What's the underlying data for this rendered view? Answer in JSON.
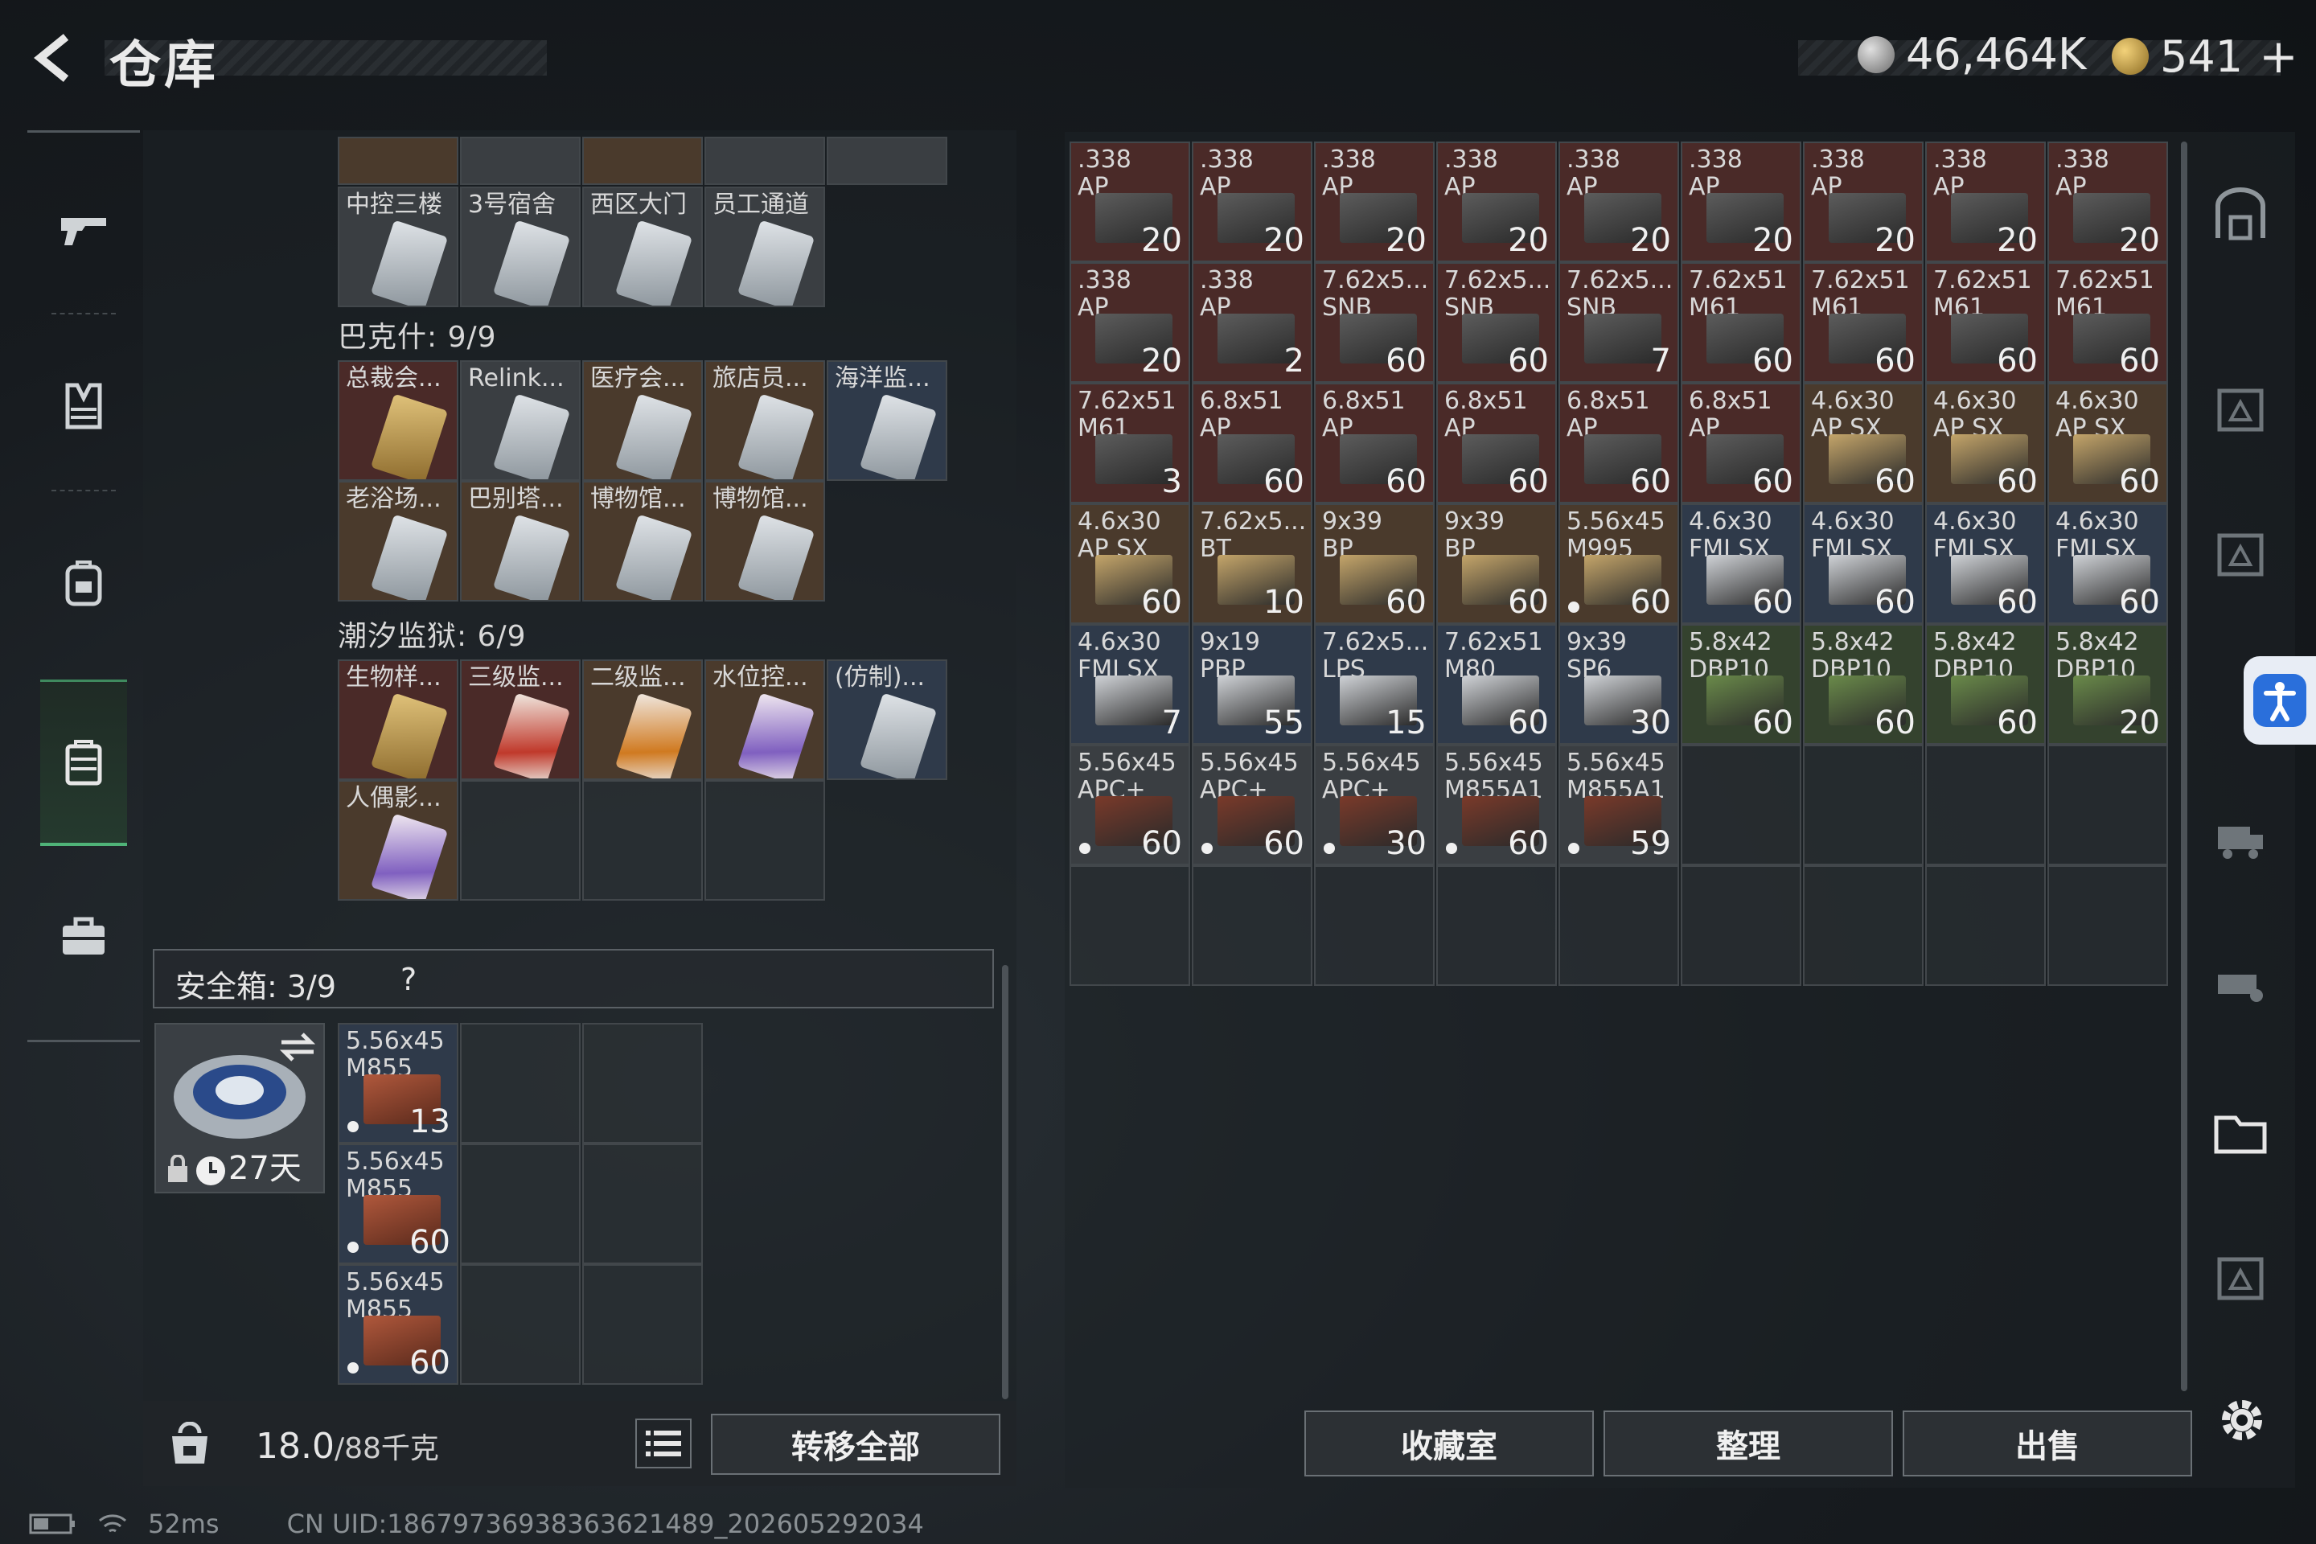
{
  "header": {
    "title": "仓库",
    "currency_silver": "46,464K",
    "currency_gold": "541",
    "plus": "+"
  },
  "left_panel": {
    "top_row_labels": [
      "中控三楼",
      "3号宿舍",
      "西区大门",
      "员工通道"
    ],
    "bakshi": {
      "label": "巴克什: 9/9",
      "items": [
        "总裁会...",
        "Relink...",
        "医疗会...",
        "旅店员...",
        "海洋监...",
        "老浴场...",
        "巴别塔...",
        "博物馆...",
        "博物馆..."
      ]
    },
    "prison": {
      "label": "潮汐监狱: 6/9",
      "items": [
        "生物样...",
        "三级监...",
        "二级监...",
        "水位控...",
        "(仿制)...",
        "人偶影..."
      ]
    },
    "safe": {
      "title": "安全箱: 3/9",
      "help": "?",
      "days": "27天",
      "items": [
        {
          "label": "5.56x45\nM855",
          "count": "13"
        },
        {
          "label": "5.56x45\nM855",
          "count": "60"
        },
        {
          "label": "5.56x45\nM855",
          "count": "60"
        }
      ]
    },
    "weight": {
      "value": "18.0",
      "unit": "/88千克"
    },
    "transfer_all": "转移全部"
  },
  "stash": {
    "items": [
      {
        "label": ".338\nAP",
        "count": "20",
        "tone": "red"
      },
      {
        "label": ".338\nAP",
        "count": "20",
        "tone": "red"
      },
      {
        "label": ".338\nAP",
        "count": "20",
        "tone": "red"
      },
      {
        "label": ".338\nAP",
        "count": "20",
        "tone": "red"
      },
      {
        "label": ".338\nAP",
        "count": "20",
        "tone": "red"
      },
      {
        "label": ".338\nAP",
        "count": "20",
        "tone": "red"
      },
      {
        "label": ".338\nAP",
        "count": "20",
        "tone": "red"
      },
      {
        "label": ".338\nAP",
        "count": "20",
        "tone": "red"
      },
      {
        "label": ".338\nAP",
        "count": "20",
        "tone": "red"
      },
      {
        "label": ".338\nAP",
        "count": "20",
        "tone": "red"
      },
      {
        "label": ".338\nAP",
        "count": "2",
        "tone": "red"
      },
      {
        "label": "7.62x5...\nSNB",
        "count": "60",
        "tone": "red"
      },
      {
        "label": "7.62x5...\nSNB",
        "count": "60",
        "tone": "red"
      },
      {
        "label": "7.62x5...\nSNB",
        "count": "7",
        "tone": "red"
      },
      {
        "label": "7.62x51\nM61",
        "count": "60",
        "tone": "red"
      },
      {
        "label": "7.62x51\nM61",
        "count": "60",
        "tone": "red"
      },
      {
        "label": "7.62x51\nM61",
        "count": "60",
        "tone": "red"
      },
      {
        "label": "7.62x51\nM61",
        "count": "60",
        "tone": "red"
      },
      {
        "label": "7.62x51\nM61",
        "count": "3",
        "tone": "red"
      },
      {
        "label": "6.8x51\nAP",
        "count": "60",
        "tone": "red"
      },
      {
        "label": "6.8x51\nAP",
        "count": "60",
        "tone": "red"
      },
      {
        "label": "6.8x51\nAP",
        "count": "60",
        "tone": "red"
      },
      {
        "label": "6.8x51\nAP",
        "count": "60",
        "tone": "red"
      },
      {
        "label": "6.8x51\nAP",
        "count": "60",
        "tone": "red"
      },
      {
        "label": "4.6x30\nAP SX",
        "count": "60",
        "tone": "brown"
      },
      {
        "label": "4.6x30\nAP SX",
        "count": "60",
        "tone": "brown"
      },
      {
        "label": "4.6x30\nAP SX",
        "count": "60",
        "tone": "brown"
      },
      {
        "label": "4.6x30\nAP SX",
        "count": "60",
        "tone": "brown"
      },
      {
        "label": "7.62x5...\nBT",
        "count": "10",
        "tone": "brown"
      },
      {
        "label": "9x39\nBP",
        "count": "60",
        "tone": "brown"
      },
      {
        "label": "9x39\nBP",
        "count": "60",
        "tone": "brown"
      },
      {
        "label": "5.56x45\nM995",
        "count": "60",
        "tone": "brown",
        "dot": true
      },
      {
        "label": "4.6x30\nFMJ SX",
        "count": "60",
        "tone": "blue"
      },
      {
        "label": "4.6x30\nFMJ SX",
        "count": "60",
        "tone": "blue"
      },
      {
        "label": "4.6x30\nFMJ SX",
        "count": "60",
        "tone": "blue"
      },
      {
        "label": "4.6x30\nFMJ SX",
        "count": "60",
        "tone": "blue"
      },
      {
        "label": "4.6x30\nFMJ SX",
        "count": "7",
        "tone": "blue"
      },
      {
        "label": "9x19\nPBP",
        "count": "55",
        "tone": "blue"
      },
      {
        "label": "7.62x5...\nLPS",
        "count": "15",
        "tone": "blue"
      },
      {
        "label": "7.62x51\nM80",
        "count": "60",
        "tone": "blue"
      },
      {
        "label": "9x39\nSP6",
        "count": "30",
        "tone": "blue"
      },
      {
        "label": "5.8x42\nDBP10",
        "count": "60",
        "tone": "green"
      },
      {
        "label": "5.8x42\nDBP10",
        "count": "60",
        "tone": "green"
      },
      {
        "label": "5.8x42\nDBP10",
        "count": "60",
        "tone": "green"
      },
      {
        "label": "5.8x42\nDBP10",
        "count": "20",
        "tone": "green"
      },
      {
        "label": "5.56x45\nAPC+",
        "count": "60",
        "tone": "grey",
        "dot": true
      },
      {
        "label": "5.56x45\nAPC+",
        "count": "60",
        "tone": "grey",
        "dot": true
      },
      {
        "label": "5.56x45\nAPC+",
        "count": "30",
        "tone": "grey",
        "dot": true
      },
      {
        "label": "5.56x45\nM855A1",
        "count": "60",
        "tone": "grey",
        "dot": true
      },
      {
        "label": "5.56x45\nM855A1",
        "count": "59",
        "tone": "grey",
        "dot": true
      }
    ],
    "buttons": {
      "collection": "收藏室",
      "sort": "整理",
      "sell": "出售"
    }
  },
  "status": {
    "ping": "52ms",
    "uid": "CN UID:1867973693836362148​9_202605292034"
  },
  "colors": {
    "red": "#4a2a28",
    "brown": "#4a3a2c",
    "blue": "#2f3a4a",
    "green": "#34422e",
    "grey": "#3a3e42",
    "accent_green": "#4fb378",
    "a11y_blue": "#2a6fdb"
  }
}
